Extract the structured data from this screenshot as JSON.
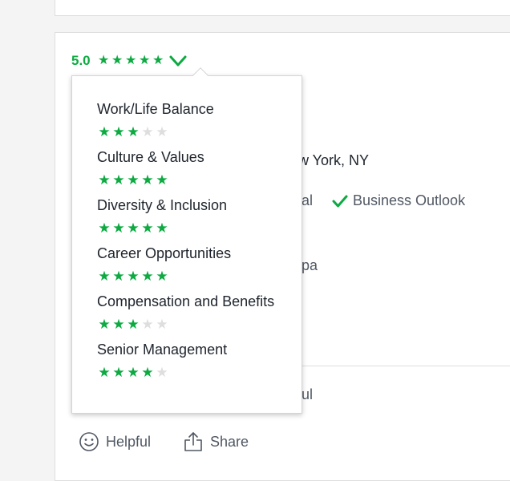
{
  "review": {
    "overall_rating": "5.0",
    "overall_stars": 5,
    "location_partial": "w York, NY",
    "status_partial": "al",
    "business_outlook_label": "Business Outlook",
    "text_partial_1": "pa",
    "text_partial_2": "ul"
  },
  "subratings": [
    {
      "label": "Work/Life Balance",
      "stars": 3
    },
    {
      "label": "Culture & Values",
      "stars": 5
    },
    {
      "label": "Diversity & Inclusion",
      "stars": 5
    },
    {
      "label": "Career Opportunities",
      "stars": 5
    },
    {
      "label": "Compensation and Benefits",
      "stars": 3
    },
    {
      "label": "Senior Management",
      "stars": 4
    }
  ],
  "actions": {
    "helpful_label": "Helpful",
    "share_label": "Share"
  },
  "colors": {
    "accent": "#0caa41",
    "empty_star": "#dedede"
  }
}
